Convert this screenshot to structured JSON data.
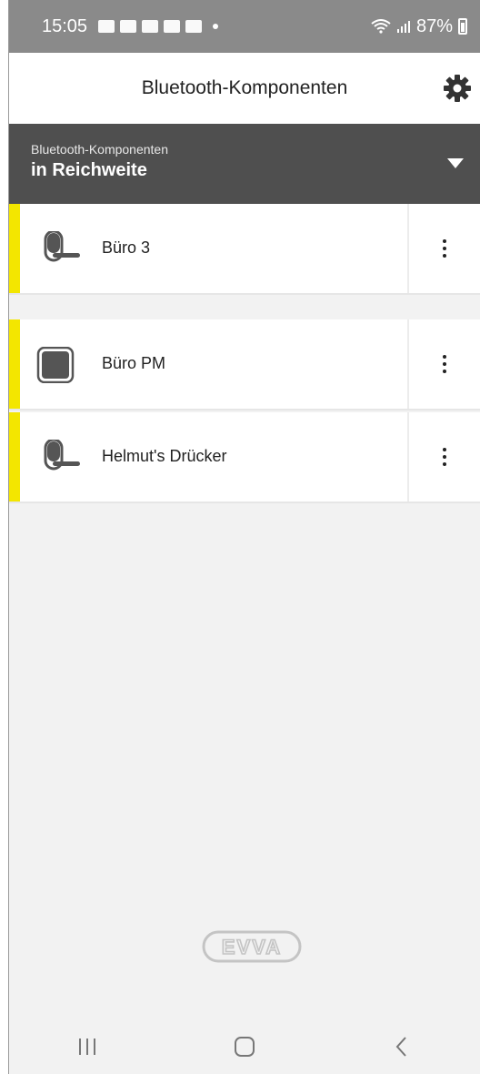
{
  "status_bar": {
    "time": "15:05",
    "battery": "87%"
  },
  "app_bar": {
    "title": "Bluetooth-Komponenten",
    "settings_icon": "gear-icon"
  },
  "filter": {
    "label": "Bluetooth-Komponenten",
    "value": "in Reichweite",
    "dropdown_icon": "triangle-down-icon"
  },
  "devices": [
    {
      "name": "Büro 3",
      "icon": "door-handle-icon"
    },
    {
      "name": "Büro PM",
      "icon": "square-reader-icon"
    },
    {
      "name": "Helmut's Drücker",
      "icon": "door-handle-icon"
    }
  ],
  "footer": {
    "logo_text": "EVVA"
  },
  "colors": {
    "accent": "#f3e600",
    "filter_bg": "#4f4f4f",
    "status_bg": "#8a8a8a"
  }
}
